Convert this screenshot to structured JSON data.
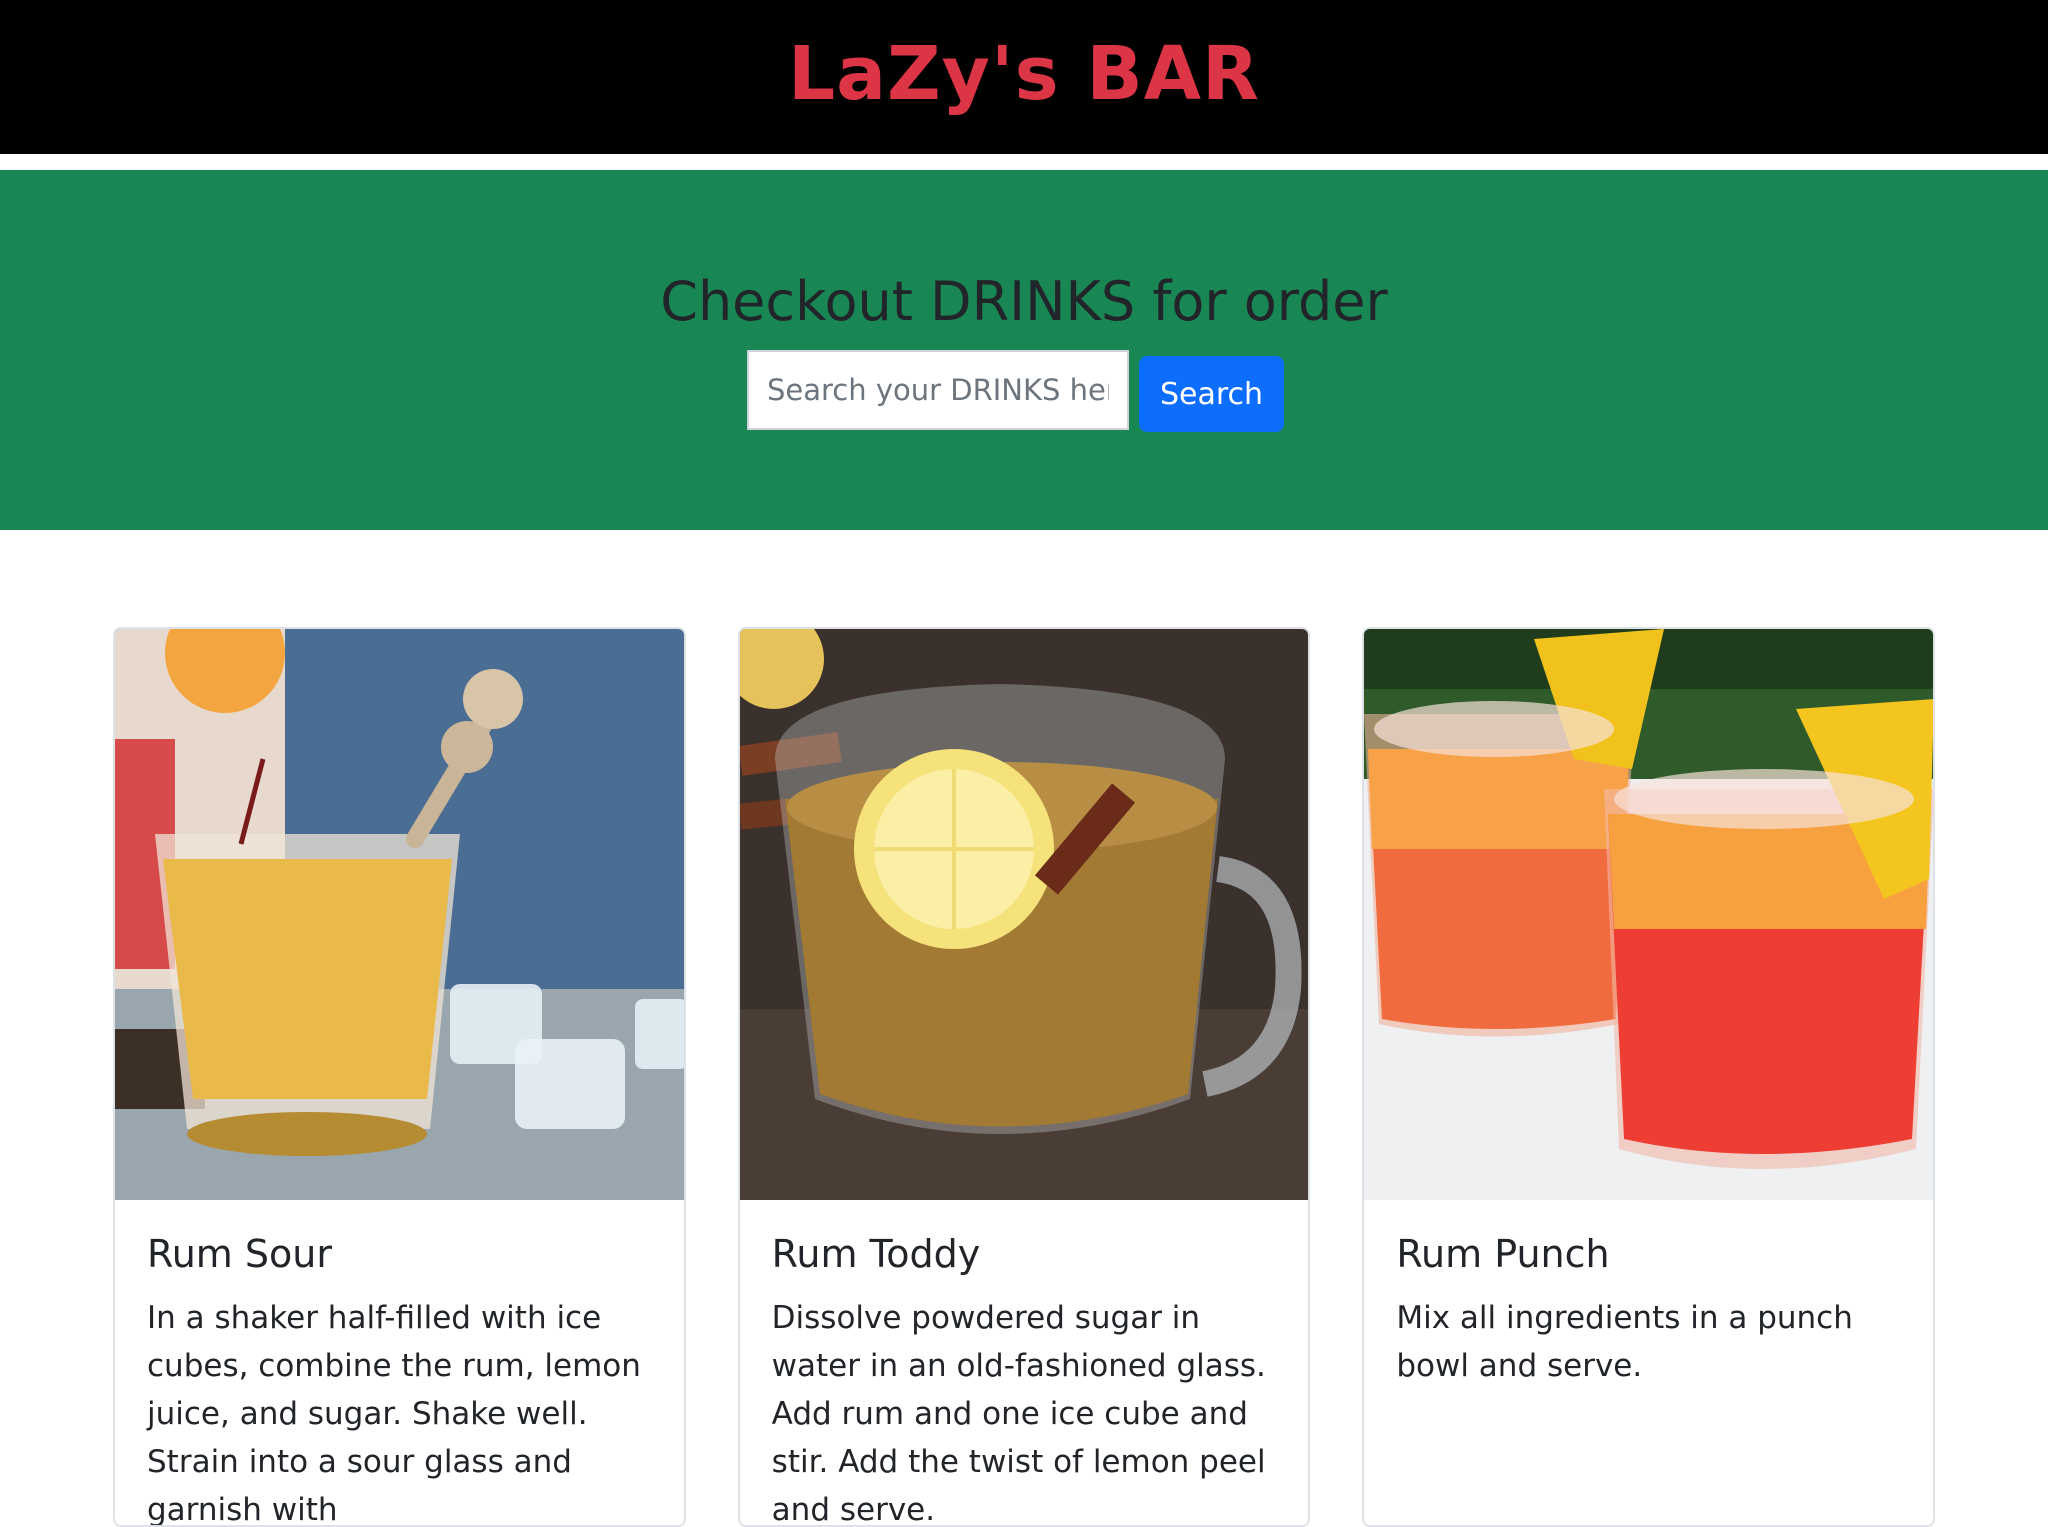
{
  "header": {
    "brand": "LaZy's BAR"
  },
  "hero": {
    "title": "Checkout DRINKS for order",
    "search_placeholder": "Search your DRINKS here",
    "search_value": "",
    "search_button": "Search"
  },
  "cards": [
    {
      "title": "Rum Sour",
      "text": "In a shaker half-filled with ice cubes, combine the rum, lemon juice, and sugar. Shake well. Strain into a sour glass and garnish with"
    },
    {
      "title": "Rum Toddy",
      "text": "Dissolve powdered sugar in water in an old-fashioned glass. Add rum and one ice cube and stir. Add the twist of lemon peel and serve."
    },
    {
      "title": "Rum Punch",
      "text": "Mix all ingredients in a punch bowl and serve."
    }
  ],
  "colors": {
    "header_bg": "#000000",
    "brand": "#dc3545",
    "hero_bg": "#198754",
    "button": "#0d6efd"
  }
}
